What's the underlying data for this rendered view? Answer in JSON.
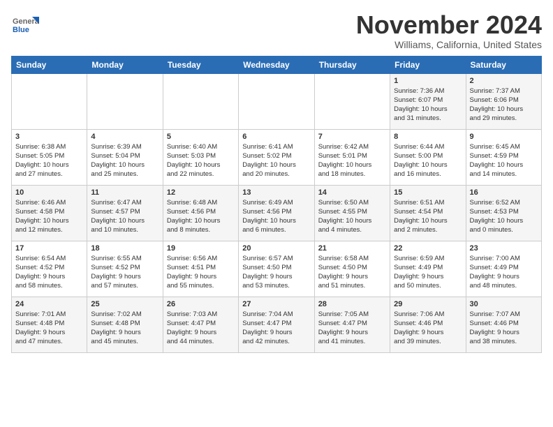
{
  "header": {
    "logo_general": "General",
    "logo_blue": "Blue",
    "title": "November 2024",
    "subtitle": "Williams, California, United States"
  },
  "weekdays": [
    "Sunday",
    "Monday",
    "Tuesday",
    "Wednesday",
    "Thursday",
    "Friday",
    "Saturday"
  ],
  "weeks": [
    [
      {
        "day": "",
        "info": ""
      },
      {
        "day": "",
        "info": ""
      },
      {
        "day": "",
        "info": ""
      },
      {
        "day": "",
        "info": ""
      },
      {
        "day": "",
        "info": ""
      },
      {
        "day": "1",
        "info": "Sunrise: 7:36 AM\nSunset: 6:07 PM\nDaylight: 10 hours\nand 31 minutes."
      },
      {
        "day": "2",
        "info": "Sunrise: 7:37 AM\nSunset: 6:06 PM\nDaylight: 10 hours\nand 29 minutes."
      }
    ],
    [
      {
        "day": "3",
        "info": "Sunrise: 6:38 AM\nSunset: 5:05 PM\nDaylight: 10 hours\nand 27 minutes."
      },
      {
        "day": "4",
        "info": "Sunrise: 6:39 AM\nSunset: 5:04 PM\nDaylight: 10 hours\nand 25 minutes."
      },
      {
        "day": "5",
        "info": "Sunrise: 6:40 AM\nSunset: 5:03 PM\nDaylight: 10 hours\nand 22 minutes."
      },
      {
        "day": "6",
        "info": "Sunrise: 6:41 AM\nSunset: 5:02 PM\nDaylight: 10 hours\nand 20 minutes."
      },
      {
        "day": "7",
        "info": "Sunrise: 6:42 AM\nSunset: 5:01 PM\nDaylight: 10 hours\nand 18 minutes."
      },
      {
        "day": "8",
        "info": "Sunrise: 6:44 AM\nSunset: 5:00 PM\nDaylight: 10 hours\nand 16 minutes."
      },
      {
        "day": "9",
        "info": "Sunrise: 6:45 AM\nSunset: 4:59 PM\nDaylight: 10 hours\nand 14 minutes."
      }
    ],
    [
      {
        "day": "10",
        "info": "Sunrise: 6:46 AM\nSunset: 4:58 PM\nDaylight: 10 hours\nand 12 minutes."
      },
      {
        "day": "11",
        "info": "Sunrise: 6:47 AM\nSunset: 4:57 PM\nDaylight: 10 hours\nand 10 minutes."
      },
      {
        "day": "12",
        "info": "Sunrise: 6:48 AM\nSunset: 4:56 PM\nDaylight: 10 hours\nand 8 minutes."
      },
      {
        "day": "13",
        "info": "Sunrise: 6:49 AM\nSunset: 4:56 PM\nDaylight: 10 hours\nand 6 minutes."
      },
      {
        "day": "14",
        "info": "Sunrise: 6:50 AM\nSunset: 4:55 PM\nDaylight: 10 hours\nand 4 minutes."
      },
      {
        "day": "15",
        "info": "Sunrise: 6:51 AM\nSunset: 4:54 PM\nDaylight: 10 hours\nand 2 minutes."
      },
      {
        "day": "16",
        "info": "Sunrise: 6:52 AM\nSunset: 4:53 PM\nDaylight: 10 hours\nand 0 minutes."
      }
    ],
    [
      {
        "day": "17",
        "info": "Sunrise: 6:54 AM\nSunset: 4:52 PM\nDaylight: 9 hours\nand 58 minutes."
      },
      {
        "day": "18",
        "info": "Sunrise: 6:55 AM\nSunset: 4:52 PM\nDaylight: 9 hours\nand 57 minutes."
      },
      {
        "day": "19",
        "info": "Sunrise: 6:56 AM\nSunset: 4:51 PM\nDaylight: 9 hours\nand 55 minutes."
      },
      {
        "day": "20",
        "info": "Sunrise: 6:57 AM\nSunset: 4:50 PM\nDaylight: 9 hours\nand 53 minutes."
      },
      {
        "day": "21",
        "info": "Sunrise: 6:58 AM\nSunset: 4:50 PM\nDaylight: 9 hours\nand 51 minutes."
      },
      {
        "day": "22",
        "info": "Sunrise: 6:59 AM\nSunset: 4:49 PM\nDaylight: 9 hours\nand 50 minutes."
      },
      {
        "day": "23",
        "info": "Sunrise: 7:00 AM\nSunset: 4:49 PM\nDaylight: 9 hours\nand 48 minutes."
      }
    ],
    [
      {
        "day": "24",
        "info": "Sunrise: 7:01 AM\nSunset: 4:48 PM\nDaylight: 9 hours\nand 47 minutes."
      },
      {
        "day": "25",
        "info": "Sunrise: 7:02 AM\nSunset: 4:48 PM\nDaylight: 9 hours\nand 45 minutes."
      },
      {
        "day": "26",
        "info": "Sunrise: 7:03 AM\nSunset: 4:47 PM\nDaylight: 9 hours\nand 44 minutes."
      },
      {
        "day": "27",
        "info": "Sunrise: 7:04 AM\nSunset: 4:47 PM\nDaylight: 9 hours\nand 42 minutes."
      },
      {
        "day": "28",
        "info": "Sunrise: 7:05 AM\nSunset: 4:47 PM\nDaylight: 9 hours\nand 41 minutes."
      },
      {
        "day": "29",
        "info": "Sunrise: 7:06 AM\nSunset: 4:46 PM\nDaylight: 9 hours\nand 39 minutes."
      },
      {
        "day": "30",
        "info": "Sunrise: 7:07 AM\nSunset: 4:46 PM\nDaylight: 9 hours\nand 38 minutes."
      }
    ]
  ]
}
